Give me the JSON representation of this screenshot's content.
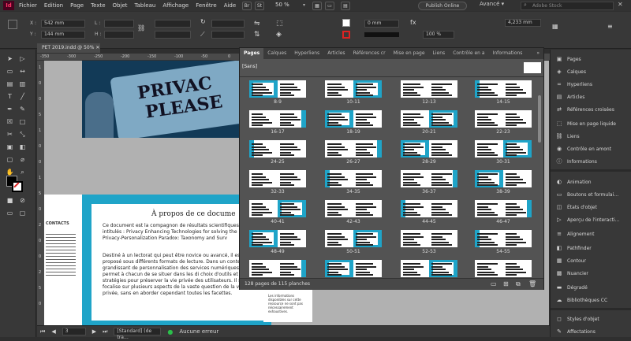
{
  "menubar": {
    "logo": "Id",
    "items": [
      "Fichier",
      "Edition",
      "Page",
      "Texte",
      "Objet",
      "Tableau",
      "Affichage",
      "Fenêtre",
      "Aide"
    ],
    "zoom": "50 %",
    "publish": "Publish Online",
    "workspace": "Avancé",
    "search_placeholder": "Adobe Stock"
  },
  "control": {
    "x_label": "X :",
    "x_value": "542 mm",
    "y_label": "Y :",
    "y_value": "144 mm",
    "w_label": "L :",
    "h_label": "H :",
    "stroke_value": "0 mm",
    "opacity_value": "100 %",
    "measure_value": "4,233 mm"
  },
  "document": {
    "tab": "PET 2019.indd @ 50%",
    "ruler_h": [
      "-350",
      "-300",
      "-250",
      "-200",
      "-150",
      "-100",
      "-50",
      "0",
      "50",
      "100",
      "150",
      "200",
      "250",
      "300",
      "350",
      "400",
      "450",
      "500",
      "550"
    ],
    "ruler_v": [
      "1",
      "0",
      "0",
      "5",
      "1",
      "0",
      "0",
      "1",
      "5",
      "0",
      "2",
      "0",
      "0",
      "2",
      "5",
      "0"
    ],
    "privacy_word1": "PRIVAC",
    "privacy_word2": "PLEASE",
    "privacy_word3": "de",
    "heading": "À propos de ce docume",
    "para1": "Ce document est la compagnon de résultats scientifiques intitulés : Privacy Enhancing Technologies for solving the Privacy-Personalization Paradox: Taxonomy and Surv",
    "para2": "Destiné à un lectorat qui peut être novice ou avancé, il est proposé sous différents formats de lecture. Dans un contexte grandissant de personnalisation des services numériques, il permet à chacun de se situer dans les di choix d'outils et de stratégies pour préserver la vie privée des utilisateurs. Il se focalise sur plusieurs aspects de la vaste question de la vie privée, sans en aborder cependant toutes les facettes.",
    "footer_text": "Pour une lecture de premier niveau sur écran, suivez les pages sur fonds bleus.",
    "page_marker": "3",
    "contacts_label": "CONTACTS",
    "sidebar_note": "Les informations disponibles sur cette ressource ne sont pas nécessairement exhaustives."
  },
  "pages_panel": {
    "tabs": [
      "Pages",
      "Calques",
      "Hyperliens",
      "Articles",
      "Références cr",
      "Mise en page",
      "Liens",
      "Contrôle en a",
      "Informations"
    ],
    "master": "[Sans]",
    "spread_labels": [
      "8-9",
      "10-11",
      "12-13",
      "14-15",
      "16-17",
      "18-19",
      "20-21",
      "22-23",
      "24-25",
      "26-27",
      "28-29",
      "30-31",
      "32-33",
      "34-35",
      "36-37",
      "38-39",
      "40-41",
      "42-43",
      "44-45",
      "46-47",
      "48-49",
      "50-51",
      "52-53",
      "54-55",
      "56-57",
      "58-59",
      "60-61",
      "62-63"
    ],
    "footer": "128 pages de 115 planches"
  },
  "dock": {
    "items": [
      {
        "label": "Pages",
        "icon": "▣"
      },
      {
        "label": "Calques",
        "icon": "◈"
      },
      {
        "label": "Hyperliens",
        "icon": "∞"
      },
      {
        "label": "Articles",
        "icon": "▤"
      },
      {
        "label": "Références croisées",
        "icon": "⇄"
      },
      {
        "label": "Mise en page liquide",
        "icon": "⬚"
      },
      {
        "label": "Liens",
        "icon": "⛓"
      },
      {
        "label": "Contrôle en amont",
        "icon": "◉"
      },
      {
        "label": "Informations",
        "icon": "ⓘ"
      },
      {
        "label": "Animation",
        "icon": "◐"
      },
      {
        "label": "Boutons et formulai…",
        "icon": "▭"
      },
      {
        "label": "États d'objet",
        "icon": "◫"
      },
      {
        "label": "Aperçu de l'interacti…",
        "icon": "▷"
      },
      {
        "label": "Alignement",
        "icon": "≡"
      },
      {
        "label": "Pathfinder",
        "icon": "◧"
      },
      {
        "label": "Contour",
        "icon": "▦"
      },
      {
        "label": "Nuancier",
        "icon": "▩"
      },
      {
        "label": "Dégradé",
        "icon": "▬"
      },
      {
        "label": "Bibliothèques CC",
        "icon": "☁"
      },
      {
        "label": "Styles d'objet",
        "icon": "◻"
      },
      {
        "label": "Affectations",
        "icon": "✎"
      }
    ]
  },
  "status": {
    "page": "3",
    "style": "[Standard] (de tra…",
    "errors": "Aucune erreur"
  },
  "colors": {
    "accent": "#1fa4c8",
    "brand": "#ff3366"
  }
}
